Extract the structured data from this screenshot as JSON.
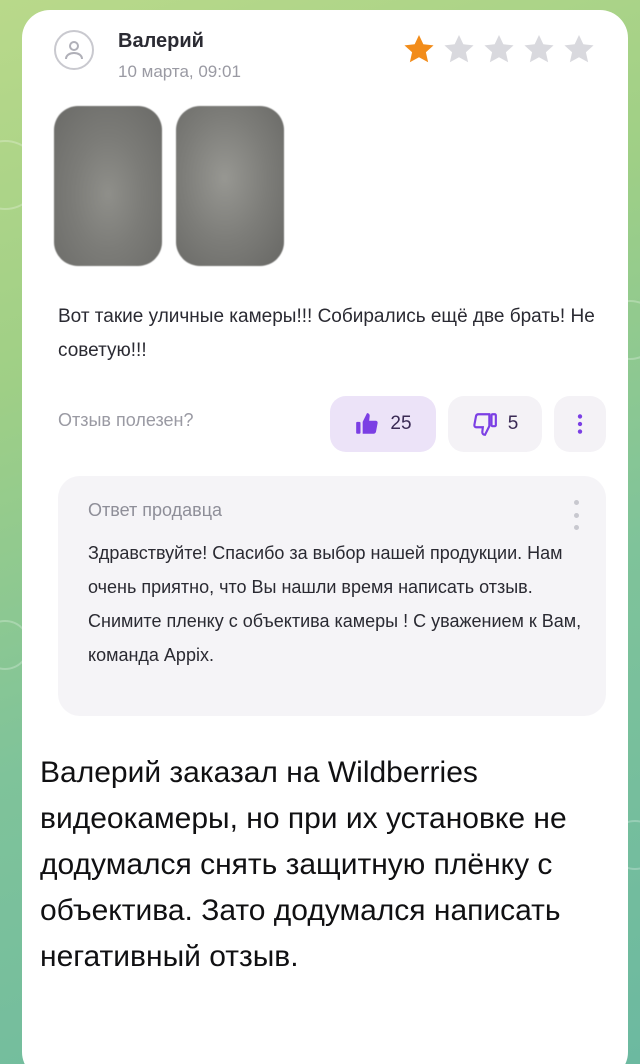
{
  "review": {
    "author": "Валерий",
    "date": "10 марта, 09:01",
    "rating": 1,
    "rating_max": 5,
    "star_filled_color": "#f28c1a",
    "star_empty_color": "#d9d9de",
    "photos_count": 2,
    "text": "Вот такие уличные камеры!!! Собирались ещё две брать! Не советую!!!",
    "helpful_label": "Отзыв полезен?",
    "likes": "25",
    "dislikes": "5"
  },
  "seller_reply": {
    "title": "Ответ продавца",
    "text": "Здравствуйте! Спасибо за выбор нашей продукции. Нам очень приятно, что Вы нашли время написать отзыв. Снимите пленку с объектива камеры ! С уважением к Вам, команда Appix."
  },
  "caption": "Валерий заказал на Wildberries видеокамеры, но при их установке не додумался снять защитную плёнку с объектива. Зато додумался написать негативный отзыв.",
  "icons": {
    "avatar": "user-icon",
    "like": "thumbs-up-icon",
    "dislike": "thumbs-down-icon",
    "more": "more-vertical-icon"
  },
  "colors": {
    "accent": "#7b3fe4",
    "like_bg": "#ece3f8"
  }
}
